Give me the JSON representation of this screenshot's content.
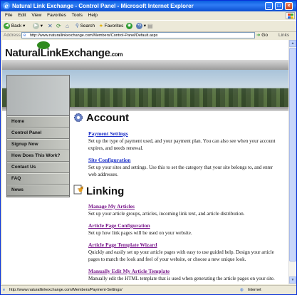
{
  "window": {
    "title": "Natural Link Exchange - Control Panel - Microsoft Internet Explorer",
    "min_glyph": "_",
    "max_glyph": "□",
    "close_glyph": "×"
  },
  "menu": [
    "File",
    "Edit",
    "View",
    "Favorites",
    "Tools",
    "Help"
  ],
  "toolbar": {
    "back": "Back",
    "search": "Search",
    "favorites": "Favorites"
  },
  "address": {
    "label": "Address",
    "url": "http://www.naturallinkexchange.com/Members/Control-Panel/Default.aspx",
    "go": "Go",
    "links": "Links"
  },
  "site": {
    "logo_main": "NaturalLinkExchange",
    "logo_suffix": ".com"
  },
  "nav": [
    "Home",
    "Control Panel",
    "Signup Now",
    "How Does This Work?",
    "Contact Us",
    "FAQ",
    "News"
  ],
  "sections": {
    "account": {
      "title": "Account",
      "items": [
        {
          "link": "Payment Settings",
          "desc": "Set up the type of payment used, and your payment plan. You can also see when your account expires, and needs renewal."
        },
        {
          "link": "Site Configuration",
          "desc": "Set up your sites and settings. Use this to set the category that your site belongs to, and enter web addresses."
        }
      ]
    },
    "linking": {
      "title": "Linking",
      "items": [
        {
          "link": "Manage My Articles",
          "desc": "Set up your article groups, articles, incoming link text, and article distribution."
        },
        {
          "link": "Article Page Configuration",
          "desc": "Set up how link pages will be used on your website."
        },
        {
          "link": "Article Page Template Wizard",
          "desc": "Quickly and easily set up your article pages with easy to use guided help. Design your article pages to match the look and feel of your website, or choose a new unique look."
        },
        {
          "link": "Manually Edit My Article Template",
          "desc": "Manually edit the HTML template that is used when generating the article pages on your site."
        }
      ]
    }
  },
  "status": {
    "url": "http://www.naturallinkexchange.com/Members/Payment-Settings/",
    "zone": "Internet"
  },
  "colors": {
    "titlebar": "#0a5fe0",
    "link_blue": "#1a2ec8",
    "link_visited": "#7a1a8c",
    "logo_green": "#2f8a1e"
  }
}
